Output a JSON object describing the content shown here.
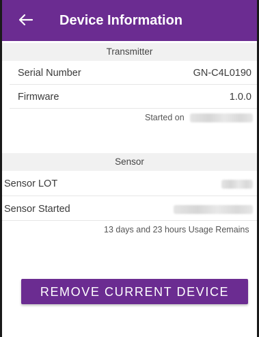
{
  "header": {
    "title": "Device Information"
  },
  "transmitter": {
    "section_title": "Transmitter",
    "serial_label": "Serial Number",
    "serial_value": "GN-C4L0190",
    "firmware_label": "Firmware",
    "firmware_value": "1.0.0",
    "started_label": "Started on"
  },
  "sensor": {
    "section_title": "Sensor",
    "lot_label": "Sensor LOT",
    "started_label": "Sensor Started",
    "usage_text": "13 days and 23 hours Usage Remains"
  },
  "actions": {
    "remove_label": "REMOVE CURRENT DEVICE"
  },
  "colors": {
    "accent": "#6b2c91",
    "section_bg": "#f1f1f1"
  }
}
